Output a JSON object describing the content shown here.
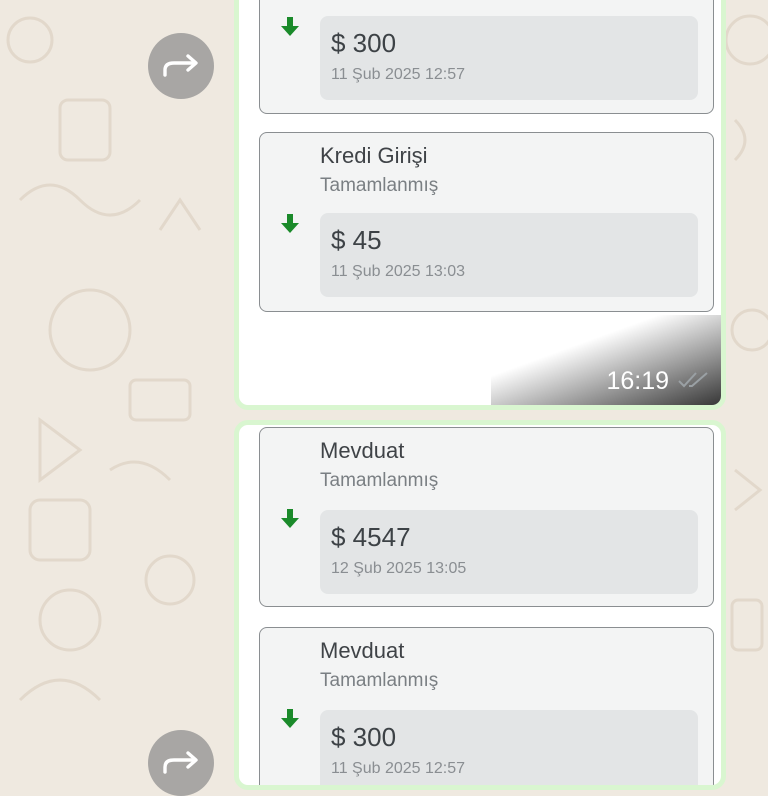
{
  "colors": {
    "chat_background": "#efe9e0",
    "bubble_border": "#d9f6d0",
    "incoming_arrow": "#1a8a2a"
  },
  "message1": {
    "time": "16:19",
    "cards": [
      {
        "title": "",
        "status": "",
        "amount": "$ 300",
        "date": "11 Şub 2025 12:57"
      },
      {
        "title": "Kredi Girişi",
        "status": "Tamamlanmış",
        "amount": "$ 45",
        "date": "11 Şub 2025 13:03"
      }
    ]
  },
  "message2": {
    "cards": [
      {
        "title": "Mevduat",
        "status": "Tamamlanmış",
        "amount": "$ 4547",
        "date": "12 Şub 2025 13:05"
      },
      {
        "title": "Mevduat",
        "status": "Tamamlanmış",
        "amount": "$ 300",
        "date": "11 Şub 2025 12:57"
      }
    ]
  },
  "icons": {
    "forward": "forward-icon",
    "incoming": "arrow-down-icon",
    "read_receipt": "double-check-icon"
  }
}
